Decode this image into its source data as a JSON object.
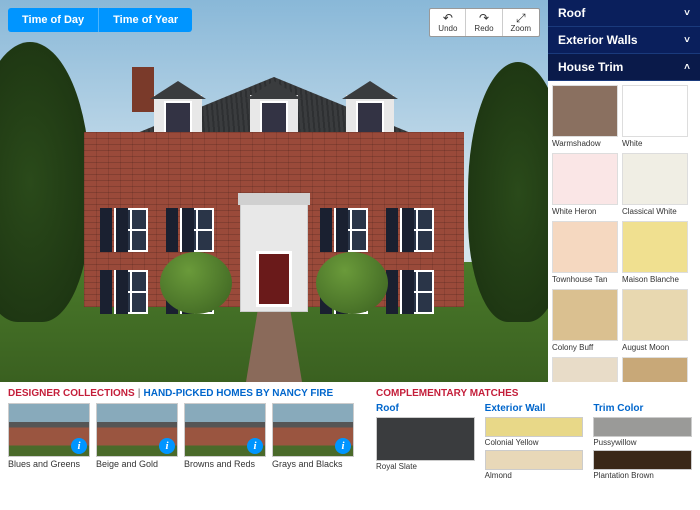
{
  "toolbar": {
    "time_day": "Time of Day",
    "time_year": "Time of Year",
    "undo": "Undo",
    "redo": "Redo",
    "zoom": "Zoom"
  },
  "sidebar": {
    "sections": [
      {
        "label": "Roof",
        "open": false
      },
      {
        "label": "Exterior Walls",
        "open": false
      },
      {
        "label": "House Trim",
        "open": true
      }
    ],
    "swatches": [
      {
        "label": "Warmshadow",
        "color": "#8a7060"
      },
      {
        "label": "White",
        "color": "#ffffff"
      },
      {
        "label": "White Heron",
        "color": "#fae6e6"
      },
      {
        "label": "Classical White",
        "color": "#f0eee4"
      },
      {
        "label": "Townhouse Tan",
        "color": "#f5d8c0"
      },
      {
        "label": "Maison Blanche",
        "color": "#f0e090"
      },
      {
        "label": "Colony Buff",
        "color": "#dac090"
      },
      {
        "label": "August Moon",
        "color": "#e8d8b0"
      },
      {
        "label": "",
        "color": "#e8dcc8"
      },
      {
        "label": "",
        "color": "#c8a878"
      }
    ]
  },
  "collections": {
    "title1": "DESIGNER COLLECTIONS",
    "title2": "HAND-PICKED HOMES BY NANCY FIRE",
    "items": [
      {
        "label": "Blues and Greens"
      },
      {
        "label": "Beige and Gold"
      },
      {
        "label": "Browns and Reds"
      },
      {
        "label": "Grays and Blacks"
      }
    ]
  },
  "matches": {
    "title": "COMPLEMENTARY MATCHES",
    "cols": [
      {
        "header": "Roof",
        "items": [
          {
            "label": "Royal Slate",
            "color": "#3a3c3e",
            "tall": true
          }
        ]
      },
      {
        "header": "Exterior Wall",
        "items": [
          {
            "label": "Colonial Yellow",
            "color": "#e8d888"
          },
          {
            "label": "Almond",
            "color": "#e8d8b8"
          }
        ]
      },
      {
        "header": "Trim Color",
        "items": [
          {
            "label": "Pussywillow",
            "color": "#9a9a98"
          },
          {
            "label": "Plantation Brown",
            "color": "#3a2818"
          }
        ]
      }
    ]
  }
}
